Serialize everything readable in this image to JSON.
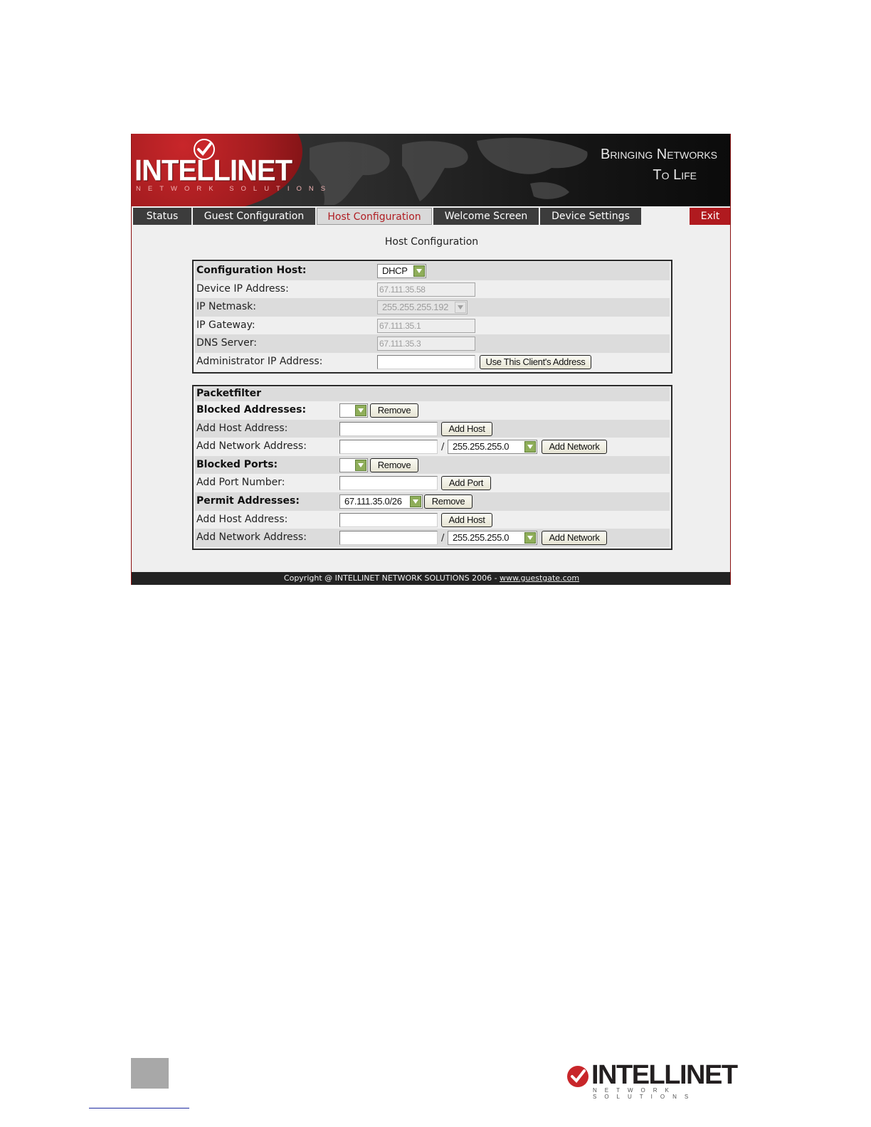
{
  "banner": {
    "brand": "INTELLINET",
    "brand_sub": "NETWORK SOLUTIONS",
    "tagline_line1": "Bringing Networks",
    "tagline_line2": "To Life"
  },
  "nav": {
    "tabs": [
      {
        "label": "Status"
      },
      {
        "label": "Guest Configuration"
      },
      {
        "label": "Host Configuration",
        "active": true
      },
      {
        "label": "Welcome Screen"
      },
      {
        "label": "Device Settings"
      }
    ],
    "exit_label": "Exit"
  },
  "page_title": "Host Configuration",
  "host_config": {
    "config_host_label": "Configuration Host:",
    "config_host_value": "DHCP",
    "device_ip_label": "Device IP Address:",
    "device_ip_value": "67.111.35.58",
    "netmask_label": "IP Netmask:",
    "netmask_value": "255.255.255.192",
    "gateway_label": "IP Gateway:",
    "gateway_value": "67.111.35.1",
    "dns_label": "DNS Server:",
    "dns_value": "67.111.35.3",
    "admin_ip_label": "Administrator IP Address:",
    "admin_ip_value": "",
    "use_client_button": "Use This Client's Address"
  },
  "packetfilter": {
    "heading": "Packetfilter",
    "blocked_addresses_label": "Blocked Addresses:",
    "blocked_addresses_value": "",
    "remove_button": "Remove",
    "add_host_label": "Add Host Address:",
    "add_host_button": "Add Host",
    "add_network_label": "Add Network Address:",
    "slash": "/",
    "network_mask_value": "255.255.255.0",
    "add_network_button": "Add Network",
    "blocked_ports_label": "Blocked Ports:",
    "blocked_ports_value": "",
    "add_port_label": "Add Port Number:",
    "add_port_button": "Add Port",
    "permit_addresses_label": "Permit Addresses:",
    "permit_addresses_value": "67.111.35.0/26"
  },
  "footer": {
    "copyright": "Copyright @ INTELLINET NETWORK SOLUTIONS 2006 - ",
    "link": "www.guestgate.com"
  },
  "page_footer": {
    "brand": "INTELLINET",
    "brand_sub": "NETWORK SOLUTIONS"
  },
  "colors": {
    "brand_red": "#b01a1f",
    "button_arrow_green": "#8fae5a"
  }
}
